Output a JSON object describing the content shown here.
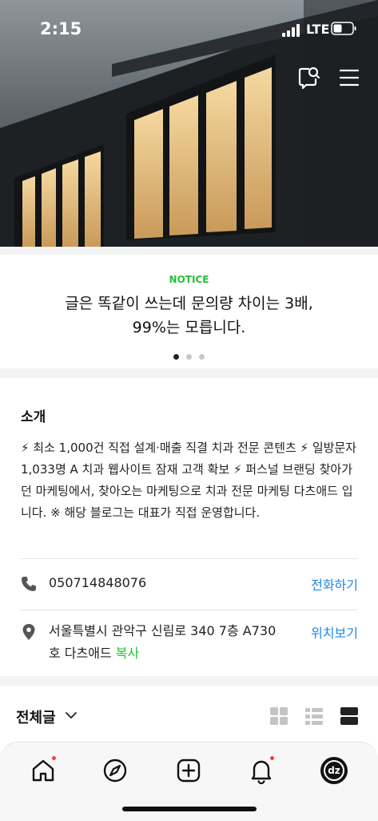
{
  "status_bar": {
    "time": "2:15",
    "network": "LTE"
  },
  "header": {
    "icons": [
      "search-chat-icon",
      "menu-icon"
    ]
  },
  "notice": {
    "label": "NOTICE",
    "title_line1": "글은 똑같이 쓰는데 문의량 차이는 3배,",
    "title_line2": "99%는 모릅니다.",
    "page_count": 3,
    "current_page": 1
  },
  "intro": {
    "title": "소개",
    "description": "⚡ 최소 1,000건 직접 설계·매출 직결 치과 전문 콘텐츠 ⚡ 일방문자 1,033명 A 치과 웹사이트 잠재 고객 확보 ⚡ 퍼스널 브랜딩 찾아가던 마케팅에서, 찾아오는 마케팅으로 치과 전문 마케팅 다츠애드 입니다. ※ 해당 블로그는 대표가 직접 운영합니다.",
    "phone": "050714848076",
    "phone_action": "전화하기",
    "address_line1": "서울특별시 관악구 신림로 340 7층 A730",
    "address_line2": "호 다츠애드",
    "copy_label": "복사",
    "map_action": "위치보기"
  },
  "posts": {
    "filter_label": "전체글",
    "view_modes": [
      "grid-view-icon",
      "list-view-icon",
      "card-view-icon"
    ],
    "active_view": "card-view-icon"
  },
  "tab_bar": {
    "items": [
      "home-icon",
      "compass-icon",
      "add-post-icon",
      "notification-bell-icon",
      "profile-avatar"
    ],
    "avatar_text": "dz"
  },
  "colors": {
    "accent_green": "#22c03a",
    "link_blue": "#1e88e5",
    "badge_red": "#ff3b30"
  }
}
